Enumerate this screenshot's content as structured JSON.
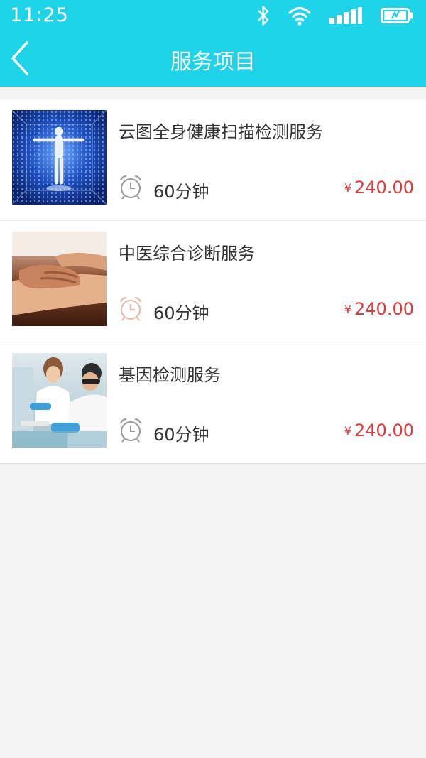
{
  "status_bar": {
    "time": "11:25",
    "icons": [
      "bluetooth-icon",
      "wifi-icon",
      "signal-icon",
      "battery-icon"
    ]
  },
  "nav": {
    "back_icon": "chevron-left-icon",
    "title": "服务项目"
  },
  "colors": {
    "header": "#1fd3e8",
    "price": "#e03a3a",
    "background": "#f3f3f3"
  },
  "services": [
    {
      "title": "云图全身健康扫描检测服务",
      "duration": "60分钟",
      "currency": "¥",
      "price": "240.00",
      "image": "body-scan-image"
    },
    {
      "title": "中医综合诊断服务",
      "duration": "60分钟",
      "currency": "¥",
      "price": "240.00",
      "image": "pulse-diagnosis-image"
    },
    {
      "title": "基因检测服务",
      "duration": "60分钟",
      "currency": "¥",
      "price": "240.00",
      "image": "lab-scientists-image"
    }
  ]
}
